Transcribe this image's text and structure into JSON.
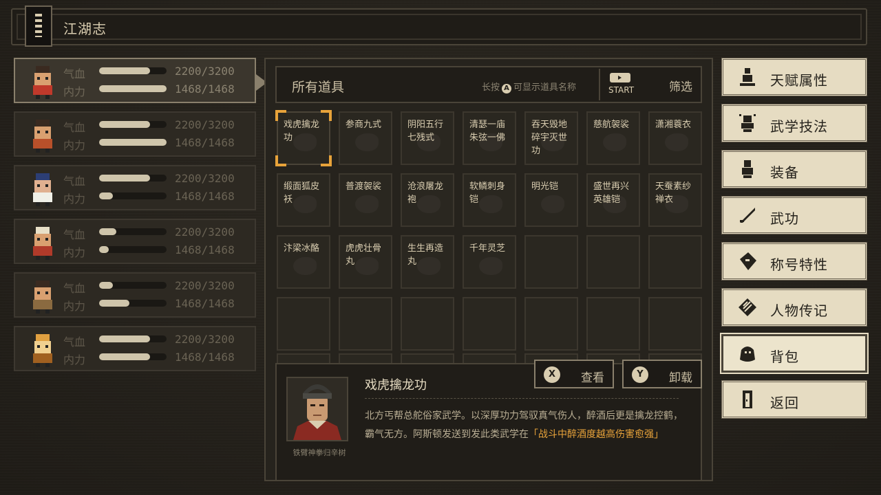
{
  "header": {
    "title": "江湖志"
  },
  "party": [
    {
      "hp_label": "气血",
      "mp_label": "内力",
      "hp": "2200/3200",
      "mp": "1468/1468",
      "hp_ratio": 0.75,
      "mp_ratio": 1.0
    },
    {
      "hp_label": "气血",
      "mp_label": "内力",
      "hp": "2200/3200",
      "mp": "1468/1468",
      "hp_ratio": 0.75,
      "mp_ratio": 1.0
    },
    {
      "hp_label": "气血",
      "mp_label": "内力",
      "hp": "2200/3200",
      "mp": "1468/1468",
      "hp_ratio": 0.75,
      "mp_ratio": 0.2
    },
    {
      "hp_label": "气血",
      "mp_label": "内力",
      "hp": "2200/3200",
      "mp": "1468/1468",
      "hp_ratio": 0.25,
      "mp_ratio": 0.14
    },
    {
      "hp_label": "气血",
      "mp_label": "内力",
      "hp": "2200/3200",
      "mp": "1468/1468",
      "hp_ratio": 0.2,
      "mp_ratio": 0.45
    },
    {
      "hp_label": "气血",
      "mp_label": "内力",
      "hp": "2200/3200",
      "mp": "1468/1468",
      "hp_ratio": 0.75,
      "mp_ratio": 0.75
    }
  ],
  "inventory": {
    "filter_label": "所有道具",
    "hint_prefix": "长按",
    "hint_key": "A",
    "hint_suffix": "可显示道具名称",
    "start_label": "START",
    "filter_button": "筛选",
    "items": [
      "戏虎擒龙功",
      "参商九式",
      "阴阳五行七残式",
      "清瑟一庙朱弦一佛",
      "吞天毁地碎宇灭世功",
      "慈航袈裟",
      "潇湘蓑衣",
      "缎面狐皮袄",
      "普渡袈裟",
      "沧浪屠龙袍",
      "软鳞刺身铠",
      "明光铠",
      "盛世再兴英雄铠",
      "天蚕素纱禅衣",
      "汴梁冰酪",
      "虎虎壮骨丸",
      "生生再造丸",
      "千年灵芝"
    ]
  },
  "detail": {
    "name": "戏虎擒龙功",
    "desc_main": "北方丐帮总舵俗家武学。以深厚功力驾驭真气伤人，醉酒后更是擒龙控鹤，霸气无方。阿斯顿发送到发此类武学在",
    "desc_highlight": "「战斗中醉酒度越高伤害愈强」",
    "portrait_caption": "铁臂神拳归辛树",
    "view_key": "X",
    "view_label": "查看",
    "unequip_key": "Y",
    "unequip_label": "卸载"
  },
  "menu": [
    {
      "label": "天赋属性",
      "icon": "character-icon"
    },
    {
      "label": "武学技法",
      "icon": "martial-skill-icon"
    },
    {
      "label": "装备",
      "icon": "equipment-icon"
    },
    {
      "label": "武功",
      "icon": "sword-icon"
    },
    {
      "label": "称号特性",
      "icon": "title-tag-icon"
    },
    {
      "label": "人物传记",
      "icon": "biography-icon"
    },
    {
      "label": "背包",
      "icon": "bag-icon"
    },
    {
      "label": "返回",
      "icon": "door-icon"
    }
  ],
  "colors": {
    "accent": "#e8a33a",
    "panel": "#26231d",
    "parchment": "#e6dcc2"
  }
}
